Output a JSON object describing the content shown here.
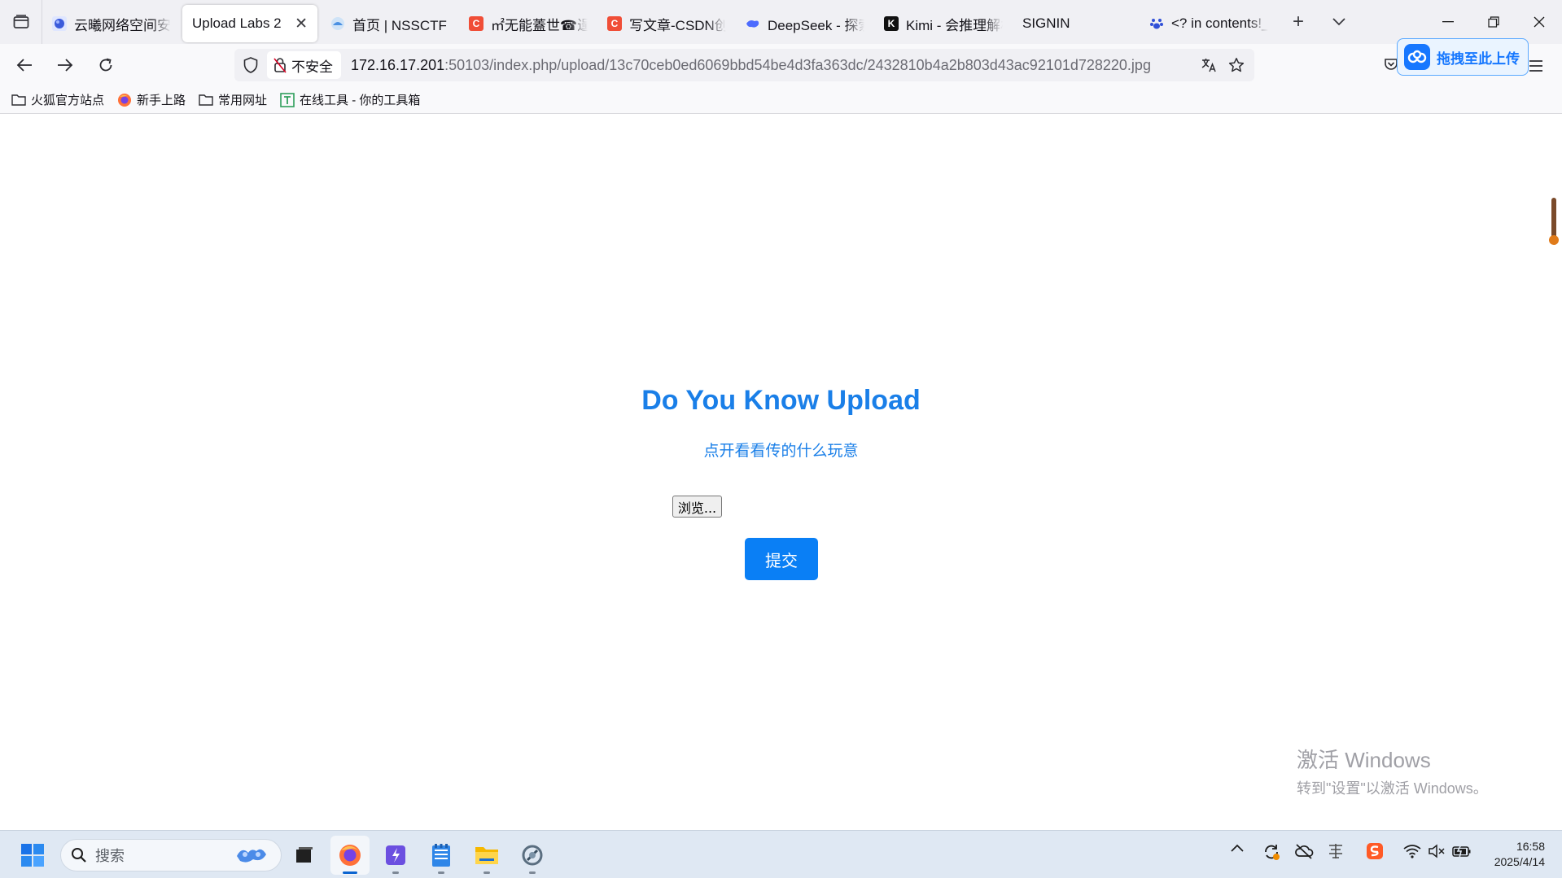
{
  "tabs": [
    {
      "title": "云曦网络空间安全",
      "icon": "globe-icon",
      "color": "#3b5bdb"
    },
    {
      "title": "Upload Labs 2",
      "icon": "none",
      "active": true
    },
    {
      "title": "首页 | NSSCTF",
      "icon": "nssctf-icon",
      "color": "#4a90e2"
    },
    {
      "title": "㎡无能蓋世☎逞何",
      "icon": "csdn-icon",
      "color": "#f04e37"
    },
    {
      "title": "写文章-CSDN创作",
      "icon": "csdn-icon",
      "color": "#f04e37"
    },
    {
      "title": "DeepSeek - 探索",
      "icon": "deepseek-icon",
      "color": "#4d6bfe"
    },
    {
      "title": "Kimi - 会推理解析",
      "icon": "kimi-icon",
      "color": "#111111"
    },
    {
      "title": "SIGNIN",
      "icon": "none"
    },
    {
      "title": "<? in contents!_",
      "icon": "paw-icon",
      "color": "#3050d8"
    }
  ],
  "tab_close_glyph": "✕",
  "new_tab_glyph": "+",
  "address": {
    "security_label": "不安全",
    "host": "172.16.17.201",
    "path": ":50103/index.php/upload/13c70ceb0ed6069bbd54be4d3fa363dc/2432810b4a2b803d43ac92101d728220.jpg"
  },
  "upload_extension": {
    "label": "拖拽至此上传",
    "color": "#1677ff"
  },
  "bookmarks": [
    {
      "label": "火狐官方站点",
      "icon": "folder-icon"
    },
    {
      "label": "新手上路",
      "icon": "firefox-icon"
    },
    {
      "label": "常用网址",
      "icon": "folder-icon"
    },
    {
      "label": "在线工具 - 你的工具箱",
      "icon": "tools-icon"
    }
  ],
  "page": {
    "title": "Do You Know Upload",
    "subtitle": "点开看看传的什么玩意",
    "browse_label": "浏览...",
    "submit_label": "提交",
    "accent": "#1a7fe8"
  },
  "watermark": {
    "line1": "激活 Windows",
    "line2": "转到\"设置\"以激活 Windows。"
  },
  "taskbar": {
    "search_placeholder": "搜索",
    "apps": [
      "windows-start-icon",
      "task-view-icon",
      "firefox-icon",
      "visual-studio-icon",
      "notepad-icon",
      "file-explorer-icon",
      "network-tool-icon"
    ],
    "clock_time": "16:58",
    "clock_date": "2025/4/14"
  }
}
